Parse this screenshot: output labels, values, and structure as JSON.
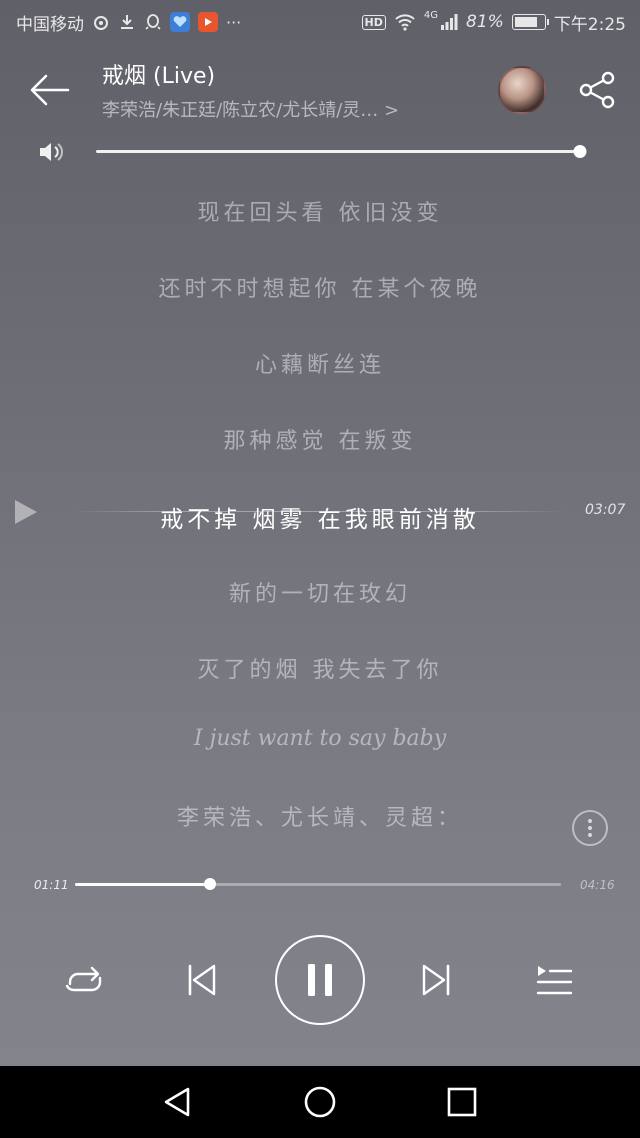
{
  "status_bar": {
    "carrier": "中国移动",
    "network": "4G",
    "battery": "81%",
    "battery_level": 0.81,
    "time": "下午2:25",
    "icons": [
      "weibo-icon",
      "download-icon",
      "qq-icon",
      "heart-app-icon",
      "video-app-icon",
      "more-dots-icon",
      "hd-icon",
      "wifi-icon",
      "signal-icon",
      "battery-icon"
    ],
    "more_glyph": "···",
    "hd_label": "HD"
  },
  "header": {
    "title": "戒烟 (Live)",
    "artists": "李荣浩/朱正廷/陈立农/尤长靖/灵… >"
  },
  "volume": {
    "level": 1.0
  },
  "lyrics": [
    {
      "text": "现在回头看 依旧没变",
      "current": false
    },
    {
      "text": "还时不时想起你 在某个夜晚",
      "current": false
    },
    {
      "text": "心藕断丝连",
      "current": false
    },
    {
      "text": "那种感觉 在叛变",
      "current": false
    },
    {
      "text": "戒不掉 烟雾 在我眼前消散",
      "current": true
    },
    {
      "text": "新的一切在玫幻",
      "current": false
    },
    {
      "text": "灭了的烟 我失去了你",
      "current": false
    },
    {
      "text": "I just want to say baby",
      "current": false
    },
    {
      "text": "李荣浩、尤长靖、灵超：",
      "current": false
    }
  ],
  "current_line_time": "03:07",
  "progress": {
    "elapsed": "01:11",
    "total": "04:16",
    "fraction": 0.277
  },
  "colors": {
    "background_top": "#5f6068",
    "background_bottom": "#85868d",
    "accent": "#ffffff",
    "nav_bar": "#000000"
  }
}
